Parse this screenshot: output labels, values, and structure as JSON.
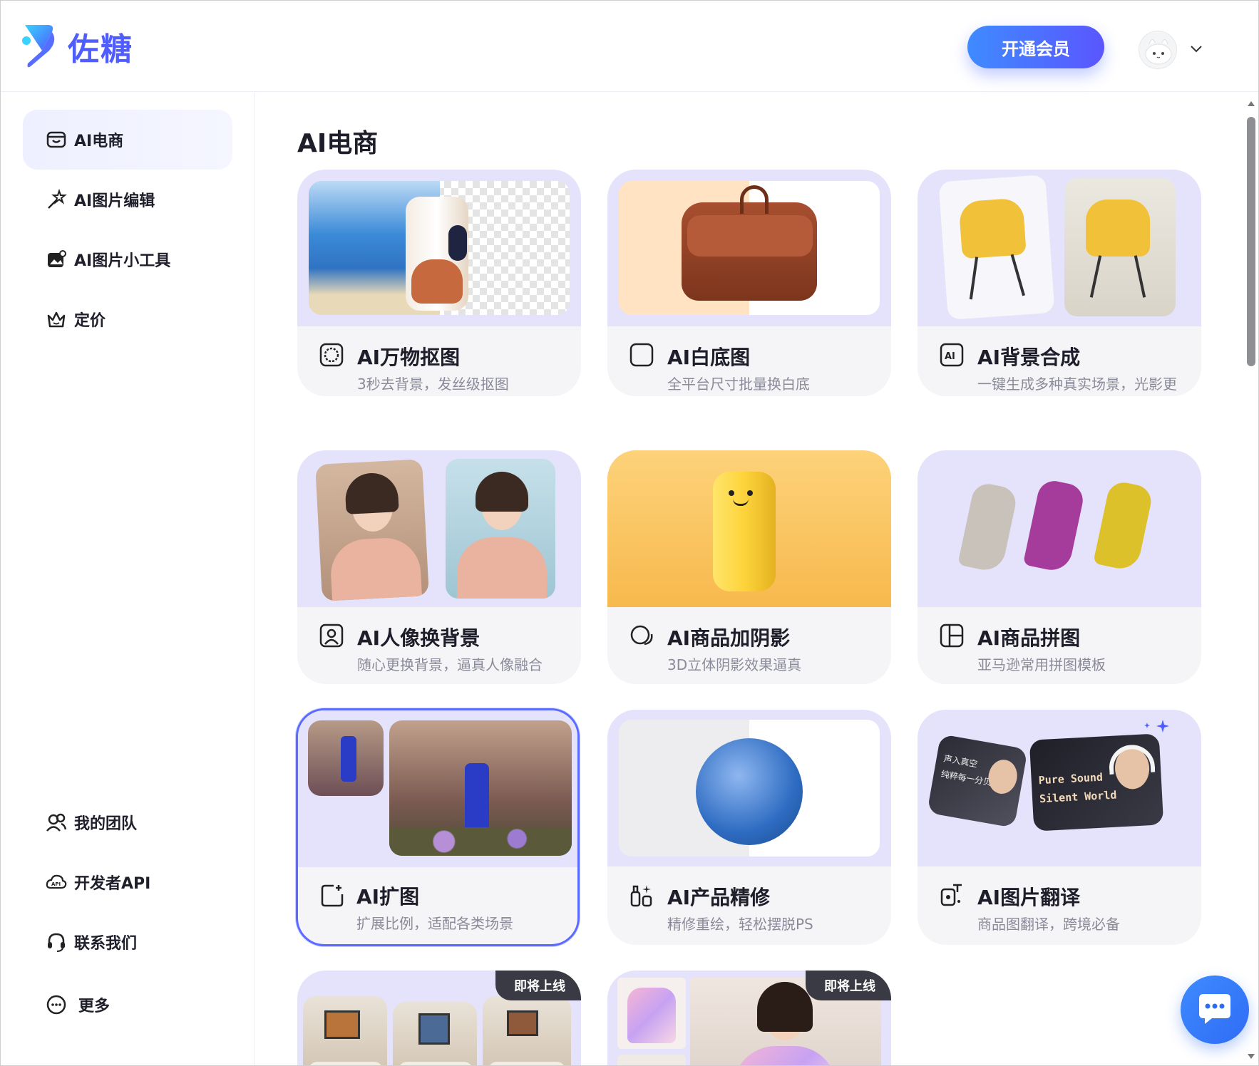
{
  "header": {
    "brand": "佐糖",
    "vip_button": "开通会员",
    "colors": {
      "brand": "#4f5dff",
      "accent": "#3f8bff"
    }
  },
  "sidebar": {
    "items": [
      {
        "label": "AI电商",
        "icon": "shop-icon",
        "active": true
      },
      {
        "label": "AI图片编辑",
        "icon": "magic-wand-icon"
      },
      {
        "label": "AI图片小工具",
        "icon": "image-tools-icon"
      },
      {
        "label": "定价",
        "icon": "crown-icon"
      }
    ],
    "bottom_items": [
      {
        "label": "我的团队",
        "icon": "team-icon"
      },
      {
        "label": "开发者API",
        "icon": "api-cloud-icon"
      },
      {
        "label": "联系我们",
        "icon": "headset-icon"
      },
      {
        "label": "更多",
        "icon": "more-dots-icon"
      }
    ]
  },
  "main": {
    "section_title": "AI电商",
    "cards": [
      {
        "title": "AI万物抠图",
        "subtitle": "3秒去背景，发丝级抠图",
        "icon": "cutout-icon"
      },
      {
        "title": "AI白底图",
        "subtitle": "全平台尺寸批量换白底",
        "icon": "square-icon"
      },
      {
        "title": "AI背景合成",
        "subtitle": "一键生成多种真实场景，光影更自然",
        "icon": "ai-background-icon"
      },
      {
        "title": "AI人像换背景",
        "subtitle": "随心更换背景，逼真人像融合",
        "icon": "portrait-icon"
      },
      {
        "title": "AI商品加阴影",
        "subtitle": "3D立体阴影效果逼真",
        "icon": "shadow-icon"
      },
      {
        "title": "AI商品拼图",
        "subtitle": "亚马逊常用拼图模板",
        "icon": "collage-icon"
      },
      {
        "title": "AI扩图",
        "subtitle": "扩展比例，适配各类场景",
        "icon": "expand-icon",
        "selected": true
      },
      {
        "title": "AI产品精修",
        "subtitle": "精修重绘，轻松摆脱PS",
        "icon": "retouch-icon"
      },
      {
        "title": "AI图片翻译",
        "subtitle": "商品图翻译，跨境必备",
        "icon": "translate-icon"
      },
      {
        "title": "",
        "subtitle": "",
        "badge": "即将上线"
      },
      {
        "title": "",
        "subtitle": "",
        "badge": "即将上线"
      }
    ],
    "translate_card_texts": {
      "left": [
        "声入真空",
        "纯粹每一分贝"
      ],
      "right": [
        "Pure Sound",
        "Silent World"
      ]
    }
  }
}
